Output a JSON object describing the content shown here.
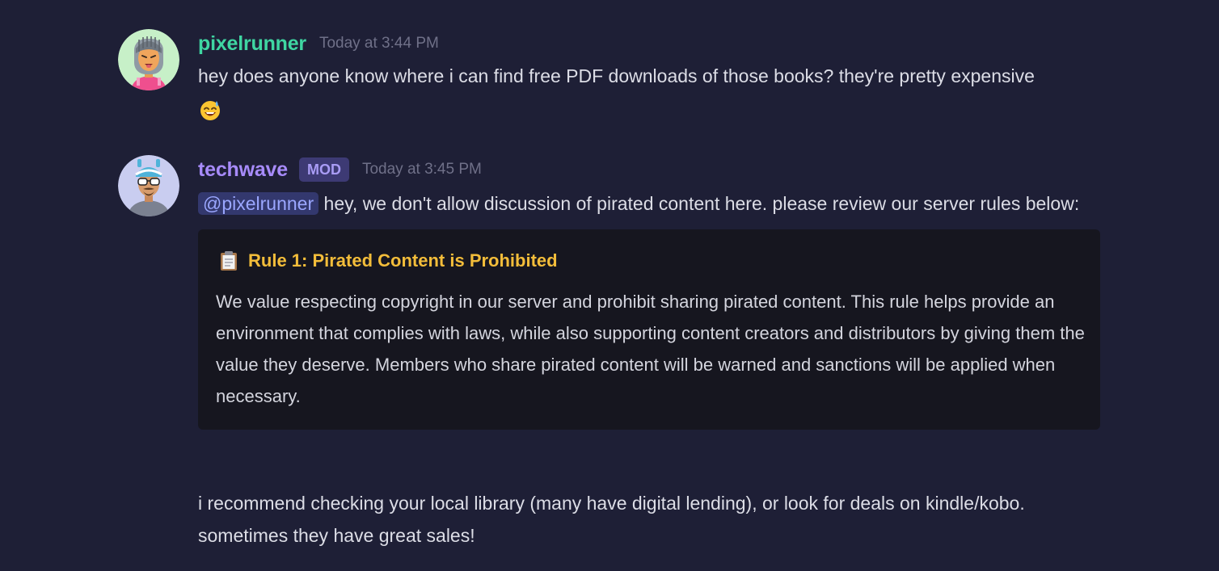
{
  "messages": [
    {
      "username": "pixelrunner",
      "timestamp": "Today at 3:44 PM",
      "text": "hey does anyone know where i can find free PDF downloads of those books? they're pretty expensive",
      "emoji": "sweat-smile-emoji"
    },
    {
      "username": "techwave",
      "badge": "MOD",
      "timestamp": "Today at 3:45 PM",
      "mention": "@pixelrunner",
      "text": "hey, we don't allow discussion of pirated content here. please review our server rules below:",
      "embed": {
        "icon": "clipboard-icon",
        "title": "Rule 1: Pirated Content is Prohibited",
        "body": "We value respecting copyright in our server and prohibit sharing pirated content. This rule helps provide an environment that complies with laws, while also supporting content creators and distributors by giving them the value they deserve. Members who share pirated content will be warned and sanctions will be applied when necessary."
      },
      "followup": "i recommend checking your local library (many have digital lending), or look for deals on kindle/kobo. sometimes they have great sales!"
    }
  ],
  "colors": {
    "background": "#1e1f36",
    "user1_name": "#3fd6a2",
    "user2_name": "#a78bfa",
    "embed_title": "#f3bd3a",
    "mention": "#9ba7ff"
  }
}
